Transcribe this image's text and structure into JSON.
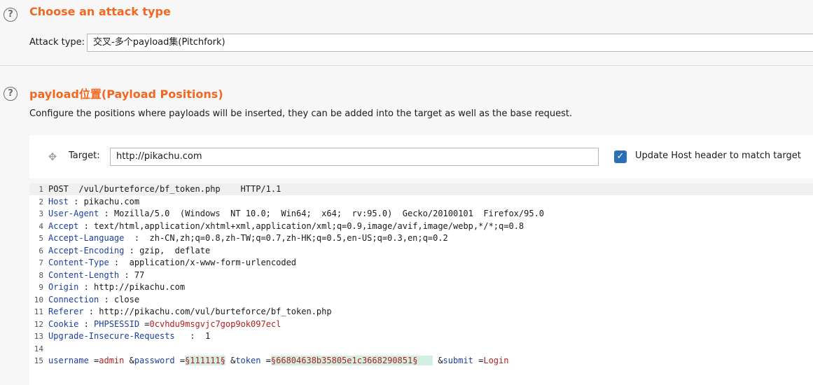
{
  "attack_section": {
    "title": "Choose an attack type",
    "attack_type_label": "Attack type:",
    "attack_type_value": "交叉-多个payload集(Pitchfork)"
  },
  "positions_section": {
    "title": "payload位置(Payload Positions)",
    "description": "Configure the positions where payloads will be inserted, they can be added into the target as well as the base request.",
    "target_label": "Target:",
    "target_value": "http://pikachu.com",
    "update_host_label": "Update Host header to match target",
    "update_host_checked": true
  },
  "request": {
    "line1": "POST  /vul/burteforce/bf_token.php    HTTP/1.1",
    "headers": [
      {
        "name": "Host",
        "sep": " : ",
        "value": "pikachu.com"
      },
      {
        "name": "User-Agent",
        "sep": " : ",
        "value": "Mozilla/5.0  (Windows  NT 10.0;  Win64;  x64;  rv:95.0)  Gecko/20100101  Firefox/95.0"
      },
      {
        "name": "Accept",
        "sep": " : ",
        "value": "text/html,application/xhtml+xml,application/xml;q=0.9,image/avif,image/webp,*/*;q=0.8"
      },
      {
        "name": "Accept-Language",
        "sep": "  :  ",
        "value": "zh-CN,zh;q=0.8,zh-TW;q=0.7,zh-HK;q=0.5,en-US;q=0.3,en;q=0.2"
      },
      {
        "name": "Accept-Encoding",
        "sep": " : ",
        "value": "gzip,  deflate"
      },
      {
        "name": "Content-Type",
        "sep": " :  ",
        "value": "application/x-www-form-urlencoded"
      },
      {
        "name": "Content-Length",
        "sep": " : ",
        "value": "77"
      },
      {
        "name": "Origin",
        "sep": " : ",
        "value": "http://pikachu.com"
      },
      {
        "name": "Connection",
        "sep": " : ",
        "value": "close"
      },
      {
        "name": "Referer",
        "sep": " : ",
        "value": "http://pikachu.com/vul/burteforce/bf_token.php"
      },
      {
        "name": "Cookie",
        "sep": " : ",
        "value": "",
        "cookie_name": "PHPSESSID",
        "cookie_eq": " =",
        "cookie_value": "0cvhdu9msgvjc7gop9ok097ecl"
      },
      {
        "name": "Upgrade-Insecure-Requests",
        "sep": "   :  ",
        "value": "1"
      }
    ],
    "body": {
      "p1_name": "username",
      "p1_eq": " =",
      "p1_value": "admin",
      "amp1": " &",
      "p2_name": "password",
      "p2_eq": " =",
      "p2_value": "§111111§",
      "amp2": " &",
      "p3_name": "token",
      "p3_eq": " =",
      "p3_value": "§66804638b35805e1c3668290851§   ",
      "amp3": " &",
      "p4_name": "submit",
      "p4_eq": " =",
      "p4_value": "Login"
    },
    "line_numbers": [
      "1",
      "2",
      "3",
      "4",
      "5",
      "6",
      "7",
      "8",
      "9",
      "10",
      "11",
      "12",
      "13",
      "14",
      "15"
    ]
  }
}
